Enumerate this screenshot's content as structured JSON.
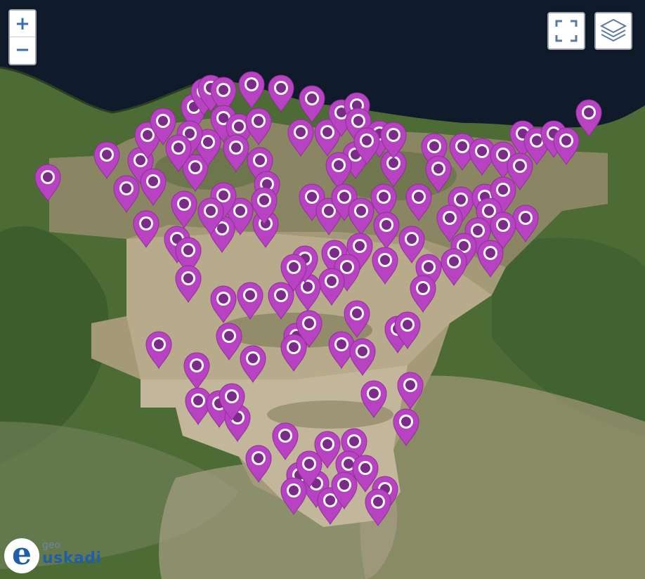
{
  "map": {
    "zoom_in_label": "+",
    "zoom_out_label": "−",
    "fullscreen_icon": "fullscreen-icon",
    "layers_icon": "layers-icon",
    "marker_color": "#b843c2",
    "marker_center_color": "#7a2a87",
    "sea_color": "#0f1a2a",
    "logo": {
      "small": "geo",
      "main": "uskadi",
      "letter": "e"
    }
  }
}
